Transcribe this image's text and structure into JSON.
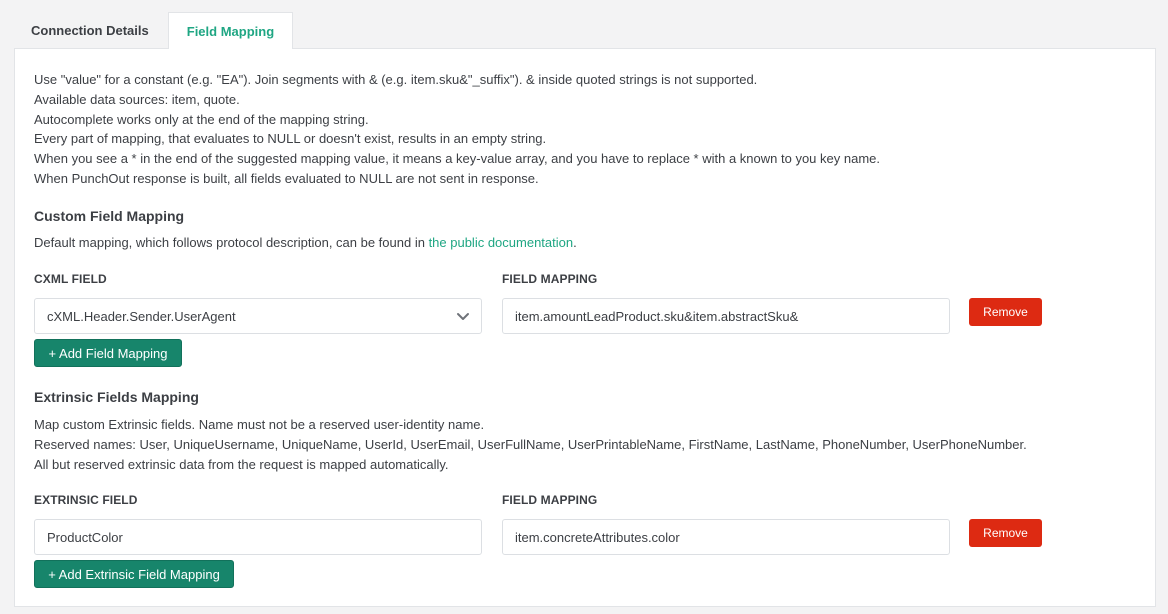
{
  "tabs": [
    {
      "label": "Connection Details",
      "active": false
    },
    {
      "label": "Field Mapping",
      "active": true
    }
  ],
  "info_lines": [
    "Use \"value\" for a constant (e.g. \"EA\"). Join segments with & (e.g. item.sku&\"_suffix\"). & inside quoted strings is not supported.",
    "Available data sources: item, quote.",
    "Autocomplete works only at the end of the mapping string.",
    "Every part of mapping, that evaluates to NULL or doesn't exist, results in an empty string.",
    "When you see a * in the end of the suggested mapping value, it means a key-value array, and you have to replace * with a known to you key name.",
    "When PunchOut response is built, all fields evaluated to NULL are not sent in response."
  ],
  "custom": {
    "heading": "Custom Field Mapping",
    "desc_prefix": "Default mapping, which follows protocol description, can be found in ",
    "link_text": "the public documentation",
    "desc_suffix": ".",
    "col_field": "cXML FIELD",
    "col_mapping": "FIELD MAPPING",
    "row": {
      "field": "cXML.Header.Sender.UserAgent",
      "mapping": "item.amountLeadProduct.sku&item.abstractSku&",
      "remove": "Remove"
    },
    "add_button": "+ Add Field Mapping"
  },
  "extrinsic": {
    "heading": "Extrinsic Fields Mapping",
    "lines": [
      "Map custom Extrinsic fields. Name must not be a reserved user-identity name.",
      "Reserved names: User, UniqueUsername, UniqueName, UserId, UserEmail, UserFullName, UserPrintableName, FirstName, LastName, PhoneNumber, UserPhoneNumber.",
      "All but reserved extrinsic data from the request is mapped automatically."
    ],
    "col_field": "EXTRINSIC FIELD",
    "col_mapping": "FIELD MAPPING",
    "row": {
      "field": "ProductColor",
      "mapping": "item.concreteAttributes.color",
      "remove": "Remove"
    },
    "add_button": "+ Add Extrinsic Field Mapping"
  },
  "colors": {
    "accent": "#1fa683",
    "primary_button": "#17856b",
    "danger_button": "#dd2a12"
  }
}
